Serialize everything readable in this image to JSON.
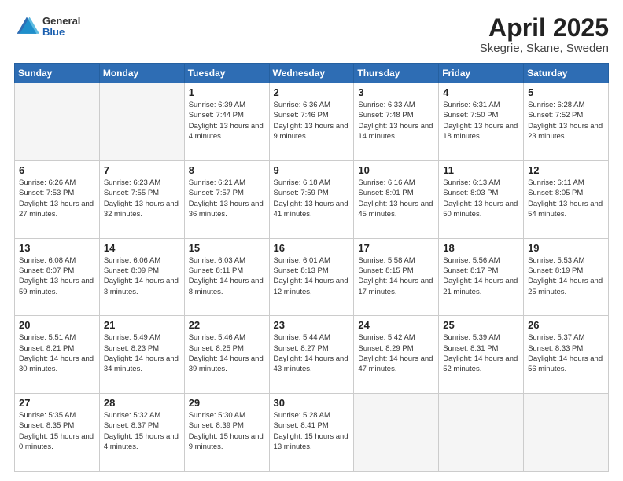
{
  "header": {
    "logo_general": "General",
    "logo_blue": "Blue",
    "title": "April 2025",
    "subtitle": "Skegrie, Skane, Sweden"
  },
  "days_of_week": [
    "Sunday",
    "Monday",
    "Tuesday",
    "Wednesday",
    "Thursday",
    "Friday",
    "Saturday"
  ],
  "weeks": [
    [
      {
        "day": "",
        "info": ""
      },
      {
        "day": "",
        "info": ""
      },
      {
        "day": "1",
        "info": "Sunrise: 6:39 AM\nSunset: 7:44 PM\nDaylight: 13 hours and 4 minutes."
      },
      {
        "day": "2",
        "info": "Sunrise: 6:36 AM\nSunset: 7:46 PM\nDaylight: 13 hours and 9 minutes."
      },
      {
        "day": "3",
        "info": "Sunrise: 6:33 AM\nSunset: 7:48 PM\nDaylight: 13 hours and 14 minutes."
      },
      {
        "day": "4",
        "info": "Sunrise: 6:31 AM\nSunset: 7:50 PM\nDaylight: 13 hours and 18 minutes."
      },
      {
        "day": "5",
        "info": "Sunrise: 6:28 AM\nSunset: 7:52 PM\nDaylight: 13 hours and 23 minutes."
      }
    ],
    [
      {
        "day": "6",
        "info": "Sunrise: 6:26 AM\nSunset: 7:53 PM\nDaylight: 13 hours and 27 minutes."
      },
      {
        "day": "7",
        "info": "Sunrise: 6:23 AM\nSunset: 7:55 PM\nDaylight: 13 hours and 32 minutes."
      },
      {
        "day": "8",
        "info": "Sunrise: 6:21 AM\nSunset: 7:57 PM\nDaylight: 13 hours and 36 minutes."
      },
      {
        "day": "9",
        "info": "Sunrise: 6:18 AM\nSunset: 7:59 PM\nDaylight: 13 hours and 41 minutes."
      },
      {
        "day": "10",
        "info": "Sunrise: 6:16 AM\nSunset: 8:01 PM\nDaylight: 13 hours and 45 minutes."
      },
      {
        "day": "11",
        "info": "Sunrise: 6:13 AM\nSunset: 8:03 PM\nDaylight: 13 hours and 50 minutes."
      },
      {
        "day": "12",
        "info": "Sunrise: 6:11 AM\nSunset: 8:05 PM\nDaylight: 13 hours and 54 minutes."
      }
    ],
    [
      {
        "day": "13",
        "info": "Sunrise: 6:08 AM\nSunset: 8:07 PM\nDaylight: 13 hours and 59 minutes."
      },
      {
        "day": "14",
        "info": "Sunrise: 6:06 AM\nSunset: 8:09 PM\nDaylight: 14 hours and 3 minutes."
      },
      {
        "day": "15",
        "info": "Sunrise: 6:03 AM\nSunset: 8:11 PM\nDaylight: 14 hours and 8 minutes."
      },
      {
        "day": "16",
        "info": "Sunrise: 6:01 AM\nSunset: 8:13 PM\nDaylight: 14 hours and 12 minutes."
      },
      {
        "day": "17",
        "info": "Sunrise: 5:58 AM\nSunset: 8:15 PM\nDaylight: 14 hours and 17 minutes."
      },
      {
        "day": "18",
        "info": "Sunrise: 5:56 AM\nSunset: 8:17 PM\nDaylight: 14 hours and 21 minutes."
      },
      {
        "day": "19",
        "info": "Sunrise: 5:53 AM\nSunset: 8:19 PM\nDaylight: 14 hours and 25 minutes."
      }
    ],
    [
      {
        "day": "20",
        "info": "Sunrise: 5:51 AM\nSunset: 8:21 PM\nDaylight: 14 hours and 30 minutes."
      },
      {
        "day": "21",
        "info": "Sunrise: 5:49 AM\nSunset: 8:23 PM\nDaylight: 14 hours and 34 minutes."
      },
      {
        "day": "22",
        "info": "Sunrise: 5:46 AM\nSunset: 8:25 PM\nDaylight: 14 hours and 39 minutes."
      },
      {
        "day": "23",
        "info": "Sunrise: 5:44 AM\nSunset: 8:27 PM\nDaylight: 14 hours and 43 minutes."
      },
      {
        "day": "24",
        "info": "Sunrise: 5:42 AM\nSunset: 8:29 PM\nDaylight: 14 hours and 47 minutes."
      },
      {
        "day": "25",
        "info": "Sunrise: 5:39 AM\nSunset: 8:31 PM\nDaylight: 14 hours and 52 minutes."
      },
      {
        "day": "26",
        "info": "Sunrise: 5:37 AM\nSunset: 8:33 PM\nDaylight: 14 hours and 56 minutes."
      }
    ],
    [
      {
        "day": "27",
        "info": "Sunrise: 5:35 AM\nSunset: 8:35 PM\nDaylight: 15 hours and 0 minutes."
      },
      {
        "day": "28",
        "info": "Sunrise: 5:32 AM\nSunset: 8:37 PM\nDaylight: 15 hours and 4 minutes."
      },
      {
        "day": "29",
        "info": "Sunrise: 5:30 AM\nSunset: 8:39 PM\nDaylight: 15 hours and 9 minutes."
      },
      {
        "day": "30",
        "info": "Sunrise: 5:28 AM\nSunset: 8:41 PM\nDaylight: 15 hours and 13 minutes."
      },
      {
        "day": "",
        "info": ""
      },
      {
        "day": "",
        "info": ""
      },
      {
        "day": "",
        "info": ""
      }
    ]
  ]
}
